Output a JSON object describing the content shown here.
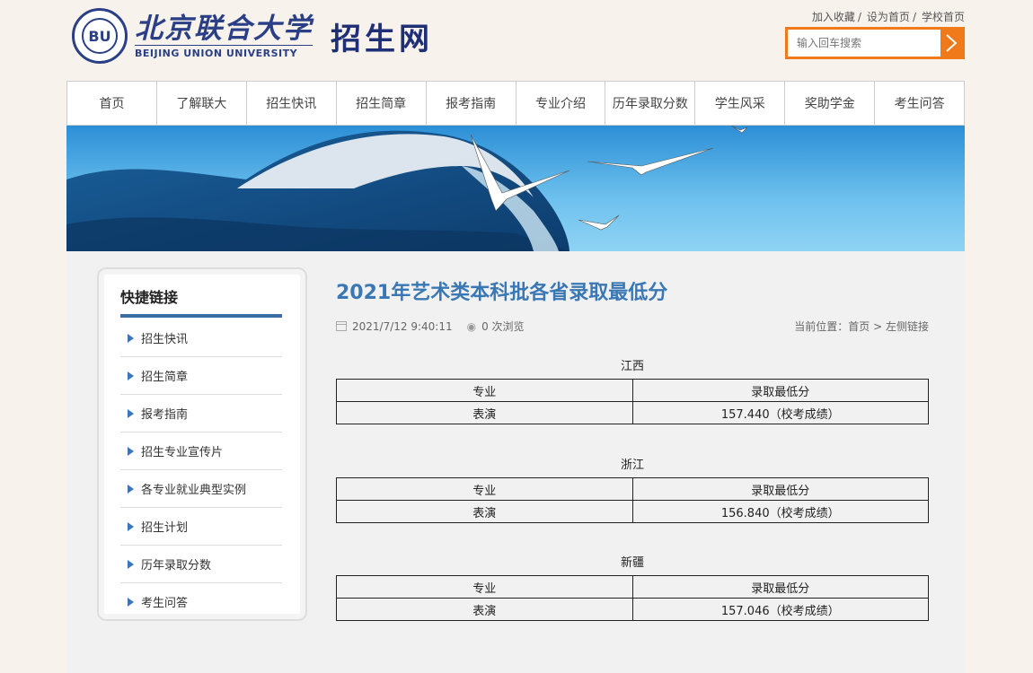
{
  "header": {
    "university_cn": "北京联合大学",
    "university_en": "BEIJING UNION UNIVERSITY",
    "site_name": "招生网",
    "top_links": [
      "加入收藏",
      "设为首页",
      "学校首页"
    ],
    "search_placeholder": "输入回车搜索"
  },
  "nav": [
    "首页",
    "了解联大",
    "招生快讯",
    "招生简章",
    "报考指南",
    "专业介绍",
    "历年录取分数",
    "学生风采",
    "奖助学金",
    "考生问答"
  ],
  "sidebar": {
    "title": "快捷链接",
    "items": [
      "招生快讯",
      "招生简章",
      "报考指南",
      "招生专业宣传片",
      "各专业就业典型实例",
      "招生计划",
      "历年录取分数",
      "考生问答"
    ]
  },
  "article": {
    "title": "2021年艺术类本科批各省录取最低分",
    "date": "2021/7/12 9:40:11",
    "views": "0 次浏览",
    "breadcrumb_prefix": "当前位置：",
    "breadcrumb_home": "首页",
    "breadcrumb_sep": ">",
    "breadcrumb_current": "左侧链接",
    "provinces": [
      {
        "name": "江西",
        "header": [
          "专业",
          "录取最低分"
        ],
        "row": [
          "表演",
          "157.440（校考成绩）"
        ]
      },
      {
        "name": "浙江",
        "header": [
          "专业",
          "录取最低分"
        ],
        "row": [
          "表演",
          "156.840（校考成绩）"
        ]
      },
      {
        "name": "新疆",
        "header": [
          "专业",
          "录取最低分"
        ],
        "row": [
          "表演",
          "157.046（校考成绩）"
        ]
      }
    ]
  },
  "colors": {
    "accent_blue": "#3a78b5",
    "search_orange": "#f07a1a",
    "logo_blue": "#2a3f86"
  }
}
